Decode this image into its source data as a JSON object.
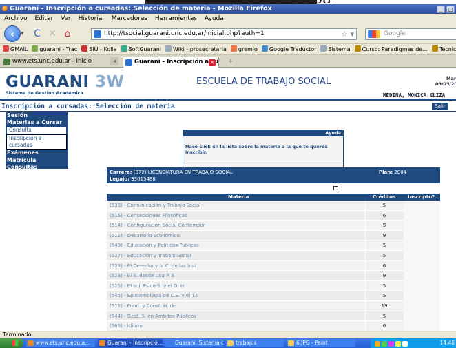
{
  "banner_text": "de Córdoba",
  "window": {
    "title": "Guarani - Inscripción a cursadas: Selección de materia - Mozilla Firefox",
    "controls": [
      "_",
      "□"
    ]
  },
  "menubar": {
    "items": [
      "Archivo",
      "Editar",
      "Ver",
      "Historial",
      "Marcadores",
      "Herramientas",
      "Ayuda"
    ]
  },
  "navbar": {
    "url": "http://tsocial.guarani.unc.edu.ar/inicial.php?auth=1",
    "search_placeholder": "Google"
  },
  "bookmarks": [
    {
      "label": "GMAIL",
      "color": "#d44"
    },
    {
      "label": "guarani - Trac",
      "color": "#7a4"
    },
    {
      "label": "SIU - Kolla",
      "color": "#c33"
    },
    {
      "label": "SoftGuarani",
      "color": "#3a8"
    },
    {
      "label": "Wiki - prosecretaria",
      "color": "#9ab"
    },
    {
      "label": "gremio",
      "color": "#e74"
    },
    {
      "label": "Google Traductor",
      "color": "#48c"
    },
    {
      "label": "Sistema",
      "color": "#9ab"
    },
    {
      "label": "Curso: Paradigmas de...",
      "color": "#b80"
    },
    {
      "label": "Tecnicatura en Gestió...",
      "color": "#b80"
    }
  ],
  "tabs": [
    {
      "label": "www.ets.unc.edu.ar - Inicio"
    },
    {
      "label": "Guarani - Inscripción a cursadas: ..."
    }
  ],
  "header": {
    "logo_main": "GUARANI",
    "logo_num": "3W",
    "logo_sub": "Sistema de Gestión Académica",
    "escuela": "ESCUELA DE TRABAJO SOCIAL",
    "right_line1": "Mar",
    "right_line2": "09/03/20",
    "user": "MEDINA, MONICA ELIZA",
    "page_title": "Inscripción a cursadas: Selección de materia",
    "salir": "Salir"
  },
  "leftmenu": {
    "items": [
      {
        "label": "Sesión"
      },
      {
        "label": "Materias a Cursar"
      },
      {
        "label": "Consulta",
        "sub": true
      },
      {
        "label": "Inscripción a cursadas",
        "sub": true,
        "selected": true
      },
      {
        "label": "Exámenes"
      },
      {
        "label": "Matrícula"
      },
      {
        "label": "Consultas"
      },
      {
        "label": "Evaluaciones Parciales"
      },
      {
        "label": "Anuncios"
      }
    ]
  },
  "ayuda": {
    "title": "Ayuda",
    "text": "Hacé click en la lista sobre la materia a la que te querés inscribir."
  },
  "carrera": {
    "label": "Carrera:",
    "value": "(872) LICENCIATURA EN TRABAJO SOCIAL",
    "legajo_label": "Legajo:",
    "legajo_value": "33015488",
    "plan_label": "Plan:",
    "plan_value": "2004"
  },
  "table": {
    "headers": [
      "Materia",
      "Créditos",
      "Inscripto?"
    ],
    "rows": [
      {
        "materia": "(536) - Comunicación y Trabajo Social",
        "creditos": "5"
      },
      {
        "materia": "(515) - Concepciones Filosóficas",
        "creditos": "6"
      },
      {
        "materia": "(514) - Configuración Social Contempor",
        "creditos": "9"
      },
      {
        "materia": "(512) - Desarrollo Económico",
        "creditos": "9"
      },
      {
        "materia": "(549) - Educación y Políticas Públicas",
        "creditos": "5"
      },
      {
        "materia": "(537) - Educación y Trabajo Social",
        "creditos": "5"
      },
      {
        "materia": "(528) - El Derecho y la C. de las Inst",
        "creditos": "6"
      },
      {
        "materia": "(523) - El S. desde una P. S",
        "creditos": "9"
      },
      {
        "materia": "(525) - El suj. Psico-S. y el D. H.",
        "creditos": "5"
      },
      {
        "materia": "(545) - Epistemología de C.S. y el T.S",
        "creditos": "5"
      },
      {
        "materia": "(511) - Fund. y Const. H. de",
        "creditos": "19"
      },
      {
        "materia": "(544) - Gest. S. en Ambitos Públicos",
        "creditos": "5"
      },
      {
        "materia": "(566) - Idioma",
        "creditos": "6"
      }
    ]
  },
  "status": "Terminado",
  "taskbar": {
    "items": [
      {
        "label": "www.ets.unc.edu.a...",
        "color": "#e78a2e"
      },
      {
        "label": "Guarani - Inscripció...",
        "color": "#e78a2e",
        "active": true
      },
      {
        "label": "Guarani. Sistema de...",
        "color": "#3b7be8"
      },
      {
        "label": "trabajos",
        "color": "#f2cc5c"
      },
      {
        "label": "6.JPG - Paint",
        "color": "#f2cc5c"
      }
    ],
    "clock": "14:48"
  }
}
